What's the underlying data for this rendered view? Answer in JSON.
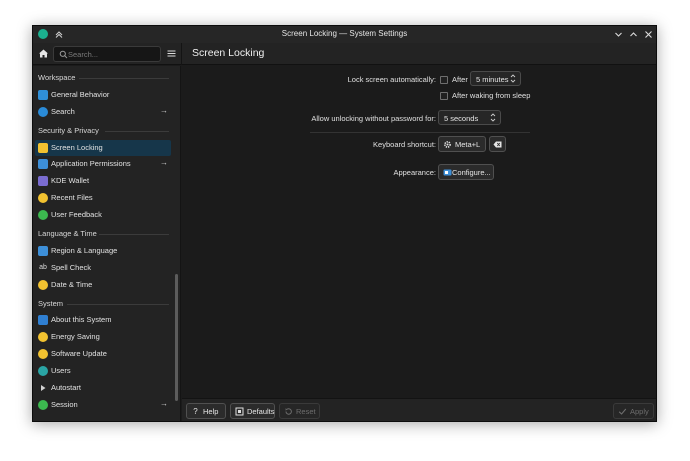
{
  "window": {
    "title": "Screen Locking — System Settings"
  },
  "toolbar": {
    "search_placeholder": "Search...",
    "page_title": "Screen Locking"
  },
  "sidebar": {
    "sections": [
      {
        "label": "Workspace",
        "items": [
          {
            "label": "General Behavior",
            "icon": "general-behavior-icon",
            "color": "#3daee9",
            "arrow": false
          },
          {
            "label": "Search",
            "icon": "search-icon",
            "color": "#2a8bd8",
            "arrow": true
          }
        ]
      },
      {
        "label": "Security & Privacy",
        "items": [
          {
            "label": "Screen Locking",
            "icon": "lock-icon",
            "color": "#f2c230",
            "arrow": false,
            "active": true
          },
          {
            "label": "Application Permissions",
            "icon": "permissions-icon",
            "color": "#3d8fd8",
            "arrow": true
          },
          {
            "label": "KDE Wallet",
            "icon": "wallet-icon",
            "color": "#7a6cd0",
            "arrow": false
          },
          {
            "label": "Recent Files",
            "icon": "recent-files-icon",
            "color": "#f2c230",
            "arrow": false
          },
          {
            "label": "User Feedback",
            "icon": "user-feedback-icon",
            "color": "#3cb94f",
            "arrow": false
          }
        ]
      },
      {
        "label": "Language & Time",
        "items": [
          {
            "label": "Region & Language",
            "icon": "region-language-icon",
            "color": "#3d8fd8",
            "arrow": false
          },
          {
            "label": "Spell Check",
            "icon": "spell-check-icon",
            "color": "#bbbbbb",
            "arrow": false
          },
          {
            "label": "Date & Time",
            "icon": "date-time-icon",
            "color": "#f2c230",
            "arrow": false
          }
        ]
      },
      {
        "label": "System",
        "items": [
          {
            "label": "About this System",
            "icon": "info-icon",
            "color": "#2f7fd1",
            "arrow": false
          },
          {
            "label": "Energy Saving",
            "icon": "energy-saving-icon",
            "color": "#f2c230",
            "arrow": false
          },
          {
            "label": "Software Update",
            "icon": "software-update-icon",
            "color": "#f2c230",
            "arrow": false
          },
          {
            "label": "Users",
            "icon": "users-icon",
            "color": "#2aa5a5",
            "arrow": false
          },
          {
            "label": "Autostart",
            "icon": "autostart-icon",
            "color": "#cccccc",
            "arrow": false
          },
          {
            "label": "Session",
            "icon": "session-icon",
            "color": "#3cb94f",
            "arrow": true
          }
        ]
      }
    ]
  },
  "settings": {
    "lock_auto_label": "Lock screen automatically:",
    "after_label": "After",
    "after_value": "5 minutes",
    "after_waking_label": "After waking from sleep",
    "unlock_label": "Allow unlocking without password for:",
    "unlock_value": "5 seconds",
    "shortcut_label": "Keyboard shortcut:",
    "shortcut_value": "Meta+L",
    "appearance_label": "Appearance:",
    "configure_label": "Configure..."
  },
  "footer": {
    "help": "Help",
    "defaults": "Defaults",
    "reset": "Reset",
    "apply": "Apply"
  }
}
